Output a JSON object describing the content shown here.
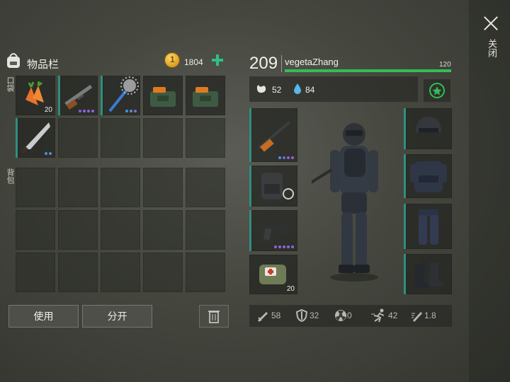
{
  "inventory": {
    "title": "物品栏",
    "coins": "1804",
    "pocket_label": "口袋",
    "backpack_label": "背包",
    "items": [
      {
        "icon": "carrot-icon",
        "qty": "20",
        "dots": []
      },
      {
        "icon": "shotgun-icon",
        "qty": "",
        "dots": [
          "#6b6bd6",
          "#8e63d8",
          "#8e63d8",
          "#8e63d8"
        ]
      },
      {
        "icon": "spiked-mace-icon",
        "qty": "",
        "dots": [
          "#4a8fe8",
          "#4a8fe8",
          "#8e63d8"
        ]
      },
      {
        "icon": "medkit-bag-icon",
        "qty": "",
        "dots": []
      },
      {
        "icon": "medkit-bag-icon",
        "qty": "",
        "dots": []
      },
      {
        "icon": "machete-icon",
        "qty": "",
        "dots": [
          "#4a8fe8",
          "#4a8fe8"
        ]
      }
    ]
  },
  "buttons": {
    "use": "使用",
    "split": "分开"
  },
  "player": {
    "level": "209",
    "name": "vegetaZhang",
    "xp": "120",
    "food": "52",
    "water": "84"
  },
  "equipment": {
    "weapon_slots": [
      {
        "icon": "sniper-rifle-icon",
        "dots": [
          "#4a8fe8",
          "#6b6bd6",
          "#8e63d8",
          "#8e63d8"
        ]
      },
      {
        "icon": "backpack-icon",
        "qty": ""
      },
      {
        "icon": "pistol-icon",
        "dots": [
          "#8e63d8",
          "#8e63d8",
          "#8e63d8",
          "#8e63d8",
          "#8e63d8"
        ]
      },
      {
        "icon": "first-aid-kit-icon",
        "qty": "20"
      }
    ],
    "armor_slots": [
      "helmet-icon",
      "tactical-vest-icon",
      "armored-pants-icon",
      "boots-icon"
    ]
  },
  "stats": {
    "attack": "58",
    "defense": "32",
    "radiation": "0",
    "speed": "42",
    "attack_speed": "1.8"
  },
  "close_label": "关闭",
  "colors": {
    "accent_green": "#2fbf55",
    "teal": "#2f8f80"
  }
}
